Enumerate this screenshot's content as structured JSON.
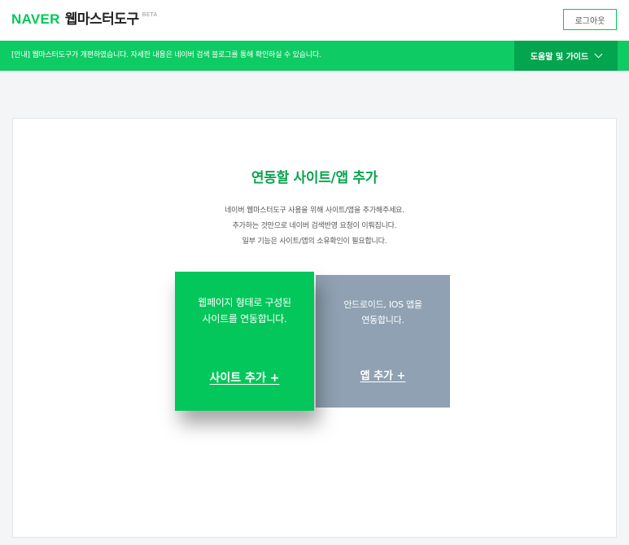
{
  "header": {
    "logo_brand": "NAVER",
    "logo_title": "웹마스터도구",
    "logo_badge": "BETA",
    "logout_label": "로그아웃"
  },
  "notice": {
    "text": "[안내] 웹마스터도구가 개편하였습니다. 자세한 내용은 네이버 검색 블로그를 통해 확인하실 수 있습니다.",
    "help_label": "도움말 및 가이드",
    "help_icon": "chevron-down-icon"
  },
  "main": {
    "title": "연동할 사이트/앱 추가",
    "desc_lines": [
      "네이버 웹마스터도구 사용을 위해 사이트/앱을 추가해주세요.",
      "추가하는 것만으로 네이버 검색반영 요청이 이뤄집니다.",
      "일부 기능은 사이트/앱의 소유확인이 필요합니다."
    ],
    "site_option": {
      "desc_lines": [
        "웹페이지 형태로 구성된",
        "사이트를 연동합니다."
      ],
      "link_label": "사이트 추가 +"
    },
    "app_option": {
      "desc_lines": [
        "안드로이드, IOS 앱을",
        "연동합니다."
      ],
      "link_label": "앱 추가 +"
    }
  },
  "colors": {
    "brand_green": "#03c75a",
    "notice_bar": "#0ecc63",
    "help_button": "#03a54e",
    "title_green": "#0aa34f",
    "app_box": "#8fa1b2"
  }
}
